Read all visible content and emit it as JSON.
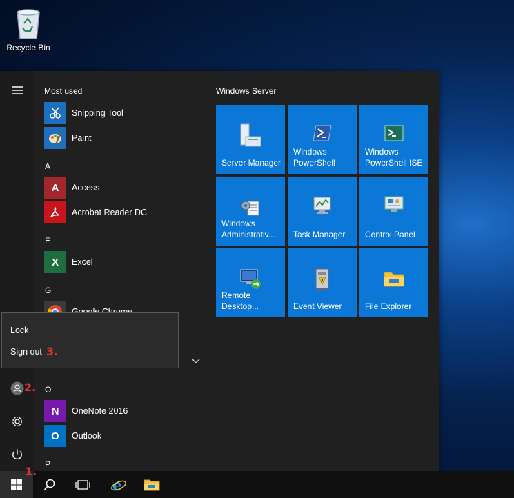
{
  "desktop": {
    "recycle_bin_label": "Recycle Bin"
  },
  "start_menu": {
    "most_used_title": "Most used",
    "most_used": [
      {
        "name": "Snipping Tool",
        "icon": "snipping-tool-icon"
      },
      {
        "name": "Paint",
        "icon": "paint-icon"
      }
    ],
    "groups": [
      {
        "letter": "A",
        "apps": [
          {
            "name": "Access",
            "icon": "access-icon"
          },
          {
            "name": "Acrobat Reader DC",
            "icon": "acrobat-icon"
          }
        ]
      },
      {
        "letter": "E",
        "apps": [
          {
            "name": "Excel",
            "icon": "excel-icon"
          }
        ]
      },
      {
        "letter": "G",
        "apps": [
          {
            "name": "Google Chrome",
            "icon": "chrome-icon"
          }
        ]
      },
      {
        "letter": "O",
        "apps": [
          {
            "name": "OneNote 2016",
            "icon": "onenote-icon"
          },
          {
            "name": "Outlook",
            "icon": "outlook-icon"
          }
        ]
      },
      {
        "letter": "P",
        "apps": []
      }
    ],
    "tiles_group_title": "Windows Server",
    "tiles": [
      {
        "label": "Server Manager",
        "icon": "server-manager-icon"
      },
      {
        "label": "Windows\nPowerShell",
        "icon": "powershell-icon"
      },
      {
        "label": "Windows\nPowerShell ISE",
        "icon": "powershell-ise-icon"
      },
      {
        "label": "Windows\nAdministrativ...",
        "icon": "admin-tools-icon"
      },
      {
        "label": "Task Manager",
        "icon": "task-manager-icon"
      },
      {
        "label": "Control Panel",
        "icon": "control-panel-icon"
      },
      {
        "label": "Remote\nDesktop...",
        "icon": "remote-desktop-icon"
      },
      {
        "label": "Event Viewer",
        "icon": "event-viewer-icon"
      },
      {
        "label": "File Explorer",
        "icon": "file-explorer-icon"
      }
    ]
  },
  "account_popup": {
    "lock_label": "Lock",
    "sign_out_label": "Sign out"
  },
  "annotations": {
    "step1": "1.",
    "step2": "2.",
    "step3": "3."
  },
  "colors": {
    "tile": "#0b78d7",
    "annotation": "#e03232",
    "menu_bg": "#202020"
  }
}
